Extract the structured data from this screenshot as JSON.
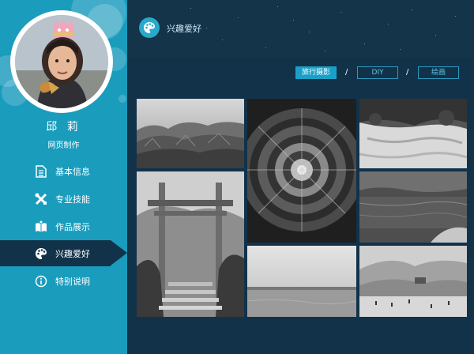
{
  "profile": {
    "name": "邱 莉",
    "role": "网页制作"
  },
  "sidebar": {
    "items": [
      {
        "label": "基本信息",
        "icon": "document-icon"
      },
      {
        "label": "专业技能",
        "icon": "tools-icon"
      },
      {
        "label": "作品展示",
        "icon": "book-icon"
      },
      {
        "label": "兴趣爱好",
        "icon": "palette-icon"
      },
      {
        "label": "特别说明",
        "icon": "info-icon"
      }
    ],
    "active_index": 3
  },
  "header": {
    "title": "兴趣爱好",
    "icon": "palette-icon"
  },
  "tabs": [
    {
      "label": "旅行摄影",
      "active": true
    },
    {
      "label": "DIY",
      "active": false
    },
    {
      "label": "绘画",
      "active": false
    }
  ],
  "tab_separator": "/",
  "gallery": {
    "photos": [
      {
        "name": "canyon-photo"
      },
      {
        "name": "stone-gate-photo"
      },
      {
        "name": "dome-ceiling-photo"
      },
      {
        "name": "waterfall-terrace-photo"
      },
      {
        "name": "lake-shore-photo"
      },
      {
        "name": "sea-horizon-photo"
      },
      {
        "name": "desert-dunes-photo"
      }
    ]
  },
  "colors": {
    "sidebar": "#1a9cbd",
    "main_bg": "#12324a",
    "accent": "#1aa0c6"
  }
}
